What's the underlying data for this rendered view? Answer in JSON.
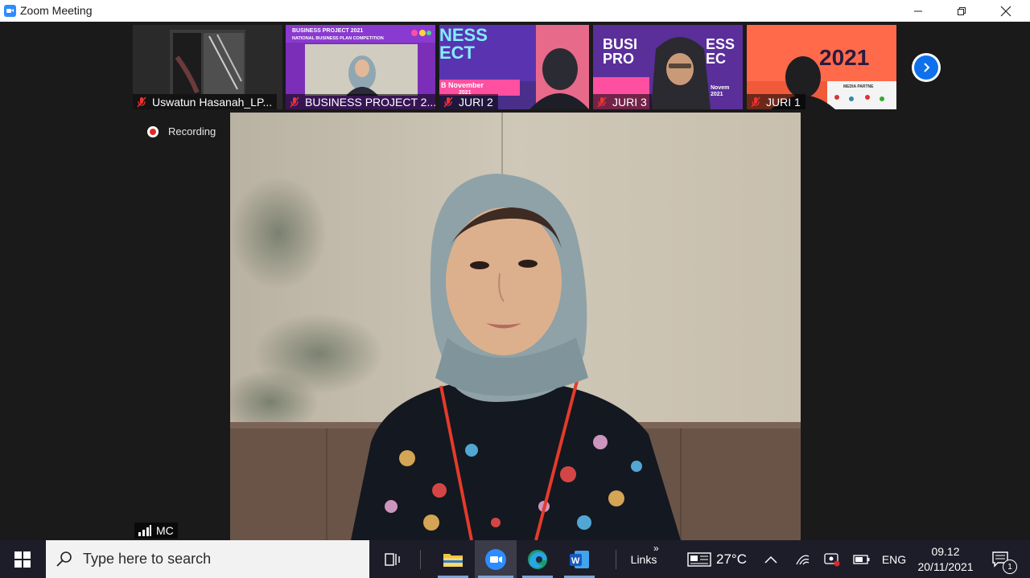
{
  "window": {
    "title": "Zoom Meeting"
  },
  "gallery": {
    "participants": [
      {
        "name": "Uswatun Hasanah_LP..."
      },
      {
        "name": "BUSINESS PROJECT 2..."
      },
      {
        "name": "JURI 2"
      },
      {
        "name": "JURI 3"
      },
      {
        "name": "JURI 1"
      }
    ],
    "banner_texts": {
      "bp_line1": "BUSINESS PROJECT 2021",
      "bp_line2": "NATIONAL BUSINESS PLAN COMPETITION",
      "juri2_line1": "NESS",
      "juri2_line2": "ECT",
      "juri2_month": "B November",
      "juri2_year": "2021",
      "juri3_line1": "BUSI",
      "juri3_line1b": "ESS",
      "juri3_line2": "PRO",
      "juri3_line2b": "EC",
      "juri3_month": "Novem",
      "juri3_year": "2021",
      "juri1_year": "2021",
      "juri1_media": "MEDIA PARTNE"
    }
  },
  "recording": {
    "label": "Recording"
  },
  "active_speaker": {
    "label": "MC"
  },
  "taskbar": {
    "search_placeholder": "Type here to search",
    "links_label": "Links",
    "weather": "27°C",
    "language": "ENG",
    "time": "09.12",
    "date": "20/11/2021",
    "notification_count": "1"
  },
  "colors": {
    "zoom_blue": "#2d8cff",
    "next_button_blue": "#0e71eb",
    "recording_red": "#e02828",
    "taskbar_bg": "#1d1d2a"
  }
}
